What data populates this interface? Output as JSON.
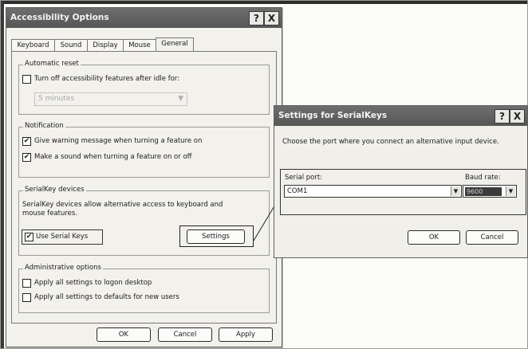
{
  "accessibility_dialog": {
    "title": "Accessibility Options",
    "help_btn": "?",
    "close_btn": "X",
    "tabs": [
      "Keyboard",
      "Sound",
      "Display",
      "Mouse",
      "General"
    ],
    "automatic_reset": {
      "legend": "Automatic reset",
      "checkbox_label": "Turn off accessibility features after idle for:",
      "checked": false,
      "idle_value": "5 minutes"
    },
    "notification": {
      "legend": "Notification",
      "items": [
        {
          "label": "Give warning message when turning a feature on",
          "checked": true
        },
        {
          "label": "Make a sound when turning a feature on or off",
          "checked": true
        }
      ]
    },
    "serialkey": {
      "legend": "SerialKey devices",
      "description_line1": "SerialKey devices allow alternative access to keyboard and",
      "description_line2": "mouse features.",
      "checkbox_label": "Use Serial Keys",
      "checked": true,
      "settings_button": "Settings"
    },
    "administrative": {
      "legend": "Administrative options",
      "items": [
        {
          "label": "Apply all settings to logon desktop",
          "checked": false
        },
        {
          "label": "Apply all settings to defaults for new users",
          "checked": false
        }
      ]
    },
    "buttons": {
      "ok": "OK",
      "cancel": "Cancel",
      "apply": "Apply"
    }
  },
  "serialkeys_dialog": {
    "title": "Settings for SerialKeys",
    "help_btn": "?",
    "close_btn": "X",
    "instruction": "Choose the port where you connect an alternative input device.",
    "serial_port_label": "Serial port:",
    "serial_port_value": "COM1",
    "baud_rate_label": "Baud rate:",
    "baud_rate_value": "9600",
    "buttons": {
      "ok": "OK",
      "cancel": "Cancel"
    }
  },
  "icons": {
    "check": "✔",
    "dropdown": "▼",
    "check_icon_name": "checkmark-icon",
    "dropdown_icon_name": "chevron-down-icon"
  }
}
